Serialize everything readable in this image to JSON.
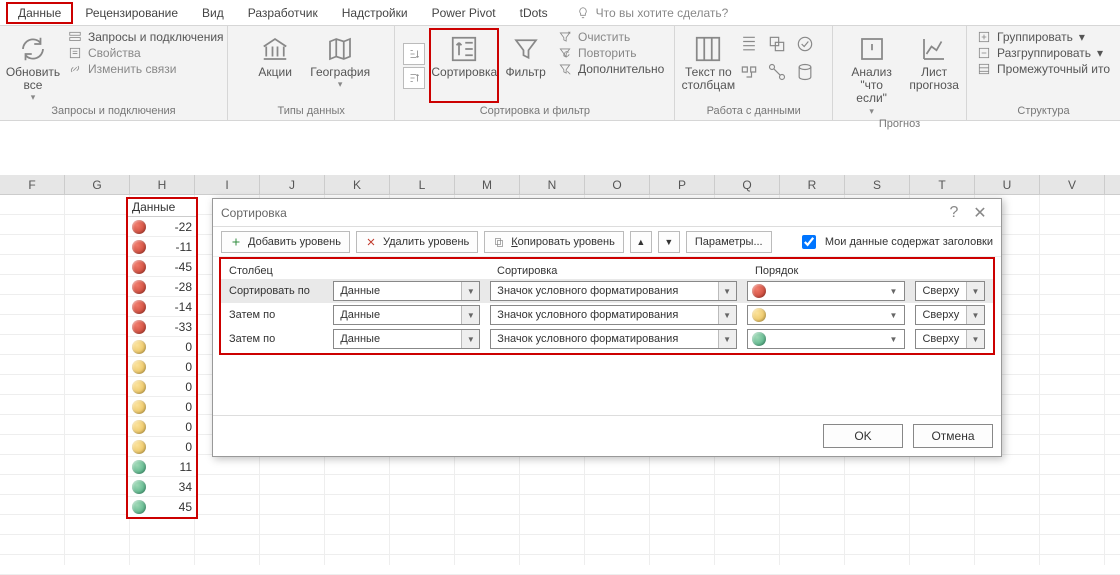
{
  "tabs": {
    "data": "Данные",
    "review": "Рецензирование",
    "view": "Вид",
    "developer": "Разработчик",
    "addins": "Надстройки",
    "powerpivot": "Power Pivot",
    "tdots": "tDots",
    "tellme": "Что вы хотите сделать?"
  },
  "ribbon": {
    "refresh_all": "Обновить\nвсе",
    "queries": "Запросы и подключения",
    "properties": "Свойства",
    "edit_links": "Изменить связи",
    "group_queries": "Запросы и подключения",
    "stocks": "Акции",
    "geography": "География",
    "group_types": "Типы данных",
    "sort": "Сортировка",
    "filter": "Фильтр",
    "clear": "Очистить",
    "reapply": "Повторить",
    "advanced": "Дополнительно",
    "group_sortfilter": "Сортировка и фильтр",
    "text_to_cols": "Текст по\nстолбцам",
    "group_datatools": "Работа с данными",
    "whatif": "Анализ \"что\nесли\"",
    "forecast": "Лист\nпрогноза",
    "group_forecast": "Прогноз",
    "group_btn": "Группировать",
    "ungroup": "Разгруппировать",
    "subtotal": "Промежуточный ито",
    "group_outline": "Структура"
  },
  "columns": [
    "F",
    "G",
    "H",
    "I",
    "J",
    "K",
    "L",
    "M",
    "N",
    "O",
    "P",
    "Q",
    "R",
    "S",
    "T",
    "U",
    "V"
  ],
  "sheet": {
    "header": "Данные",
    "rows": [
      {
        "c": "red",
        "v": "-22"
      },
      {
        "c": "red",
        "v": "-11"
      },
      {
        "c": "red",
        "v": "-45"
      },
      {
        "c": "red",
        "v": "-28"
      },
      {
        "c": "red",
        "v": "-14"
      },
      {
        "c": "red",
        "v": "-33"
      },
      {
        "c": "yel",
        "v": "0"
      },
      {
        "c": "yel",
        "v": "0"
      },
      {
        "c": "yel",
        "v": "0"
      },
      {
        "c": "yel",
        "v": "0"
      },
      {
        "c": "yel",
        "v": "0"
      },
      {
        "c": "yel",
        "v": "0"
      },
      {
        "c": "grn",
        "v": "11"
      },
      {
        "c": "grn",
        "v": "34"
      },
      {
        "c": "grn",
        "v": "45"
      }
    ]
  },
  "dialog": {
    "title": "Сортировка",
    "add_level": "Добавить уровень",
    "del_level": "Удалить уровень",
    "copy_level": "Копировать уровень",
    "params": "Параметры...",
    "headers_chk": "Мои данные содержат заголовки",
    "hdr_col": "Столбец",
    "hdr_sort": "Сортировка",
    "hdr_order": "Порядок",
    "sort_by": "Сортировать по",
    "then_by": "Затем по",
    "col_val": "Данные",
    "sort_val": "Значок условного форматирования",
    "order_top": "Сверху",
    "ok": "OK",
    "cancel": "Отмена",
    "rows": [
      {
        "label": "sort_by",
        "dot": "red"
      },
      {
        "label": "then_by",
        "dot": "yel"
      },
      {
        "label": "then_by",
        "dot": "grn"
      }
    ]
  }
}
